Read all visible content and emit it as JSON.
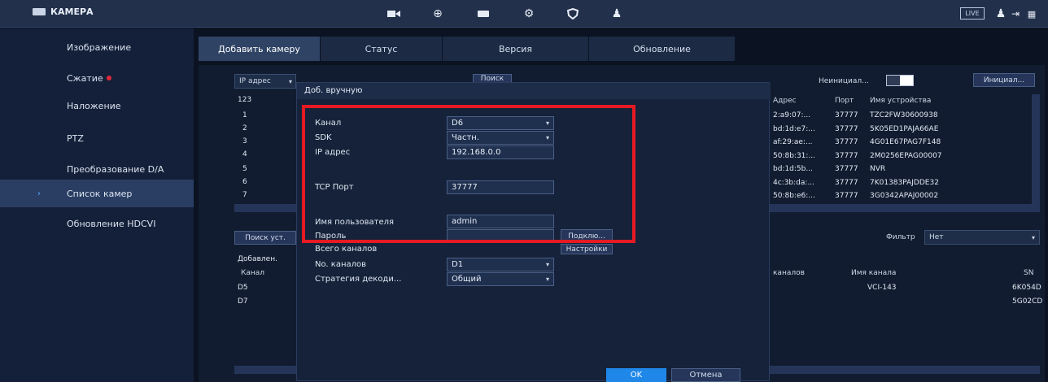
{
  "topbar": {
    "app_title": "КАМЕРА",
    "live_label": "LIVE",
    "icons": [
      "camera-icon",
      "network-icon",
      "storage-icon",
      "system-icon",
      "security-icon",
      "account-icon"
    ]
  },
  "sidebar": {
    "items": [
      {
        "label": "Изображение"
      },
      {
        "label": "Сжатие"
      },
      {
        "label": "Наложение"
      },
      {
        "label": "PTZ"
      },
      {
        "label": "Преобразование D/A"
      },
      {
        "label": "Список камер"
      },
      {
        "label": "Обновление HDCVI"
      }
    ]
  },
  "tabs": [
    "Добавить камеру",
    "Статус",
    "Версия",
    "Обновление"
  ],
  "search_bar": {
    "ip_select": "IP адрес",
    "search_button": "Поиск"
  },
  "uninit": {
    "label": "Неинициал...",
    "init_button": "Инициал..."
  },
  "device_table": {
    "headers": [
      "Адрес",
      "Порт",
      "Имя устройства"
    ],
    "row_numbers": [
      "123",
      "1",
      "2",
      "3",
      "4",
      "5",
      "6",
      "7"
    ],
    "rows": [
      [
        "2:a9:07:...",
        "37777",
        "TZC2FW30600938"
      ],
      [
        "bd:1d:e7:...",
        "37777",
        "5K05ED1PAJA66AE"
      ],
      [
        "af:29:ae:...",
        "37777",
        "4G01E67PAG7F148"
      ],
      [
        "50:8b:31:...",
        "37777",
        "2M0256EPAG00007"
      ],
      [
        "bd:1d:5b...",
        "37777",
        "NVR"
      ],
      [
        "4c:3b:da:...",
        "37777",
        "7K01383PAJDDE32"
      ],
      [
        "50:8b:e6:...",
        "37777",
        "3G0342APAJ00002"
      ]
    ]
  },
  "search_device_button": "Поиск уст.",
  "filter": {
    "label": "Фильтр",
    "value": "Нет"
  },
  "added_table": {
    "title": "Добавлен.",
    "headers": [
      "Канал",
      "каналов",
      "Имя канала",
      "SN"
    ],
    "rows": [
      {
        "channel": "D5",
        "name": "VCI-143",
        "sn": "6K054D"
      },
      {
        "channel": "D7",
        "name": "",
        "sn": "5G02CD"
      }
    ]
  },
  "dialog": {
    "title": "Доб. вручную",
    "channel_label": "Канал",
    "channel_value": "D6",
    "sdk_label": "SDK",
    "sdk_value": "Частн.",
    "ip_label": "IP адрес",
    "ip_value": "192.168.0.0",
    "tcp_label": "TCP Порт",
    "tcp_value": "37777",
    "user_label": "Имя пользователя",
    "user_value": "admin",
    "password_label": "Пароль",
    "connect_button": "Подклю...",
    "total_channels_label": "Всего каналов",
    "settings_button": "Настройки",
    "channel_no_label": "No. каналов",
    "channel_no_value": "D1",
    "strategy_label": "Стратегия декоди...",
    "strategy_value": "Общий",
    "ok_button": "OK",
    "cancel_button": "Отмена"
  },
  "colors": {
    "highlight_border": "#e51a22",
    "ok_button": "#1f87e8",
    "active_tab": "#2f4365"
  }
}
